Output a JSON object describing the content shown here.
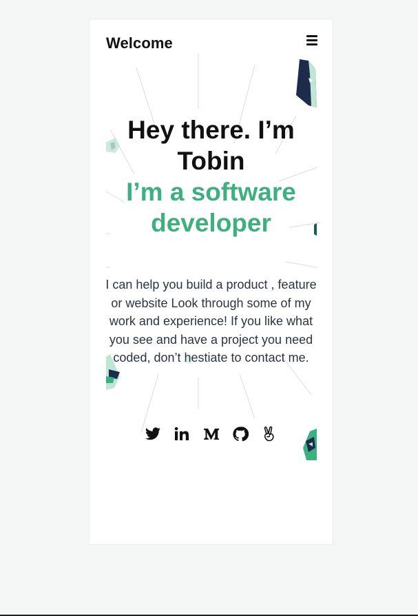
{
  "header": {
    "brand": "Welcome",
    "menu_icon": "hamburger-menu-icon"
  },
  "hero": {
    "headline": "Hey there. I’m Tobin",
    "subheadline": "I’m a software developer",
    "bio": "I can help you build a product , feature or website Look through some of my work and experience! If you like what you see and have a project you need coded, don’t hestiate to contact me."
  },
  "socials": [
    {
      "name": "twitter",
      "icon": "twitter-icon"
    },
    {
      "name": "linkedin",
      "icon": "linkedin-icon"
    },
    {
      "name": "medium",
      "icon": "medium-icon"
    },
    {
      "name": "github",
      "icon": "github-icon"
    },
    {
      "name": "peace",
      "icon": "peace-hand-icon"
    }
  ],
  "colors": {
    "accent": "#3db07f",
    "text": "#111111",
    "body_text": "#2c3340",
    "decor_navy": "#1d2c4d",
    "decor_mint": "#bfe6d4",
    "page_bg": "#f5f7f6"
  }
}
